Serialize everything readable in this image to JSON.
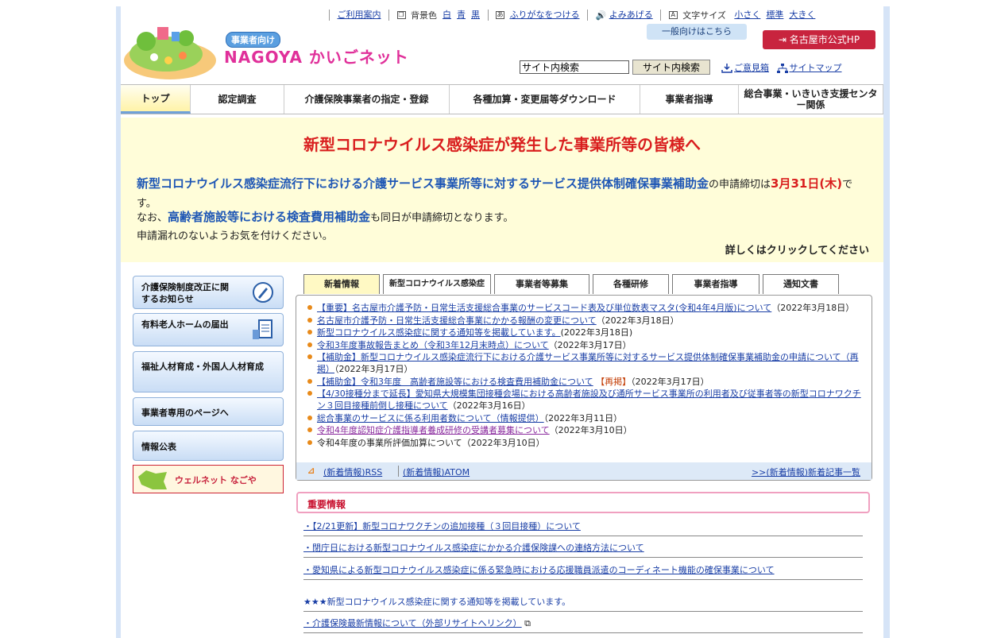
{
  "util": {
    "guide": "ご利用案内",
    "bg_label": "背景色",
    "bg_white": "白",
    "bg_blue": "青",
    "bg_black": "黒",
    "furigana": "ふりがなをつける",
    "read": "よみあげる",
    "size_label": "文字サイズ",
    "size_small": "小さく",
    "size_std": "標準",
    "size_large": "大きく"
  },
  "header": {
    "logo_sub": "事業者向け",
    "logo_main": "NAGOYA かいごネット",
    "general": "一般向けはこちら",
    "city_hp": "名古屋市公式HP",
    "search_value": "サイト内検索",
    "search_button": "サイト内検索",
    "opinion": "ご意見箱",
    "sitemap": "サイトマップ"
  },
  "nav": {
    "top": "トップ",
    "survey": "認定調査",
    "designation": "介護保険事業者の指定・登録",
    "download": "各種加算・変更届等ダウンロード",
    "guidance": "事業者指導",
    "general_support": "総合事業・いきいき支援センター関係"
  },
  "banner": {
    "title": "新型コロナウイルス感染症が発生した事業所等の皆様へ",
    "line1_bold": "新型コロナウイルス感染症流行下における介護サービス事業所等に対するサービス提供体制確保事業補助金",
    "line1_mid": "の申請締切は",
    "line1_date": "3月31日(木)",
    "line1_end": "です。",
    "line2_pre": "なお、",
    "line2_bold": "高齢者施設等における検査費用補助金",
    "line2_end": "も同日が申請締切となります。",
    "line3": "申請漏れのないようお気を付けください。",
    "more": "詳しくはクリックしてください"
  },
  "side": {
    "reform": "介護保険制度改正に関するお知らせ",
    "nursing_home": "有料老人ホームの届出",
    "welfare": "福祉人材育成・外国人人材育成",
    "business": "事業者専用のページへ",
    "info": "情報公表",
    "welnet": "ウェルネット なごや"
  },
  "tabs": [
    "新着情報",
    "新型コロナウイルス感染症",
    "事業者等募集",
    "各種研修",
    "事業者指導",
    "通知文書"
  ],
  "news": [
    {
      "link": "【重要】名古屋市介護予防・日常生活支援総合事業のサービスコード表及び単位数表マスタ(令和4年4月版)について",
      "date": "（2022年3月18日）"
    },
    {
      "link": "名古屋市介護予防・日常生活支援総合事業にかかる報酬の変更について",
      "date": "（2022年3月18日）"
    },
    {
      "link": "新型コロナウイルス感染症に関する通知等を掲載しています。",
      "date": "(2022年3月18日)"
    },
    {
      "link": "令和3年度事故報告まとめ（令和3年12月末時点）について",
      "date": "（2022年3月17日）"
    },
    {
      "link": "【補助金】新型コロナウイルス感染症流行下における介護サービス事業所等に対するサービス提供体制確保事業補助金の申請について（再掲）",
      "date": "（2022年3月17日）"
    },
    {
      "link": "【補助金】令和3年度　高齢者施設等における検査費用補助金について",
      "tag": "【再掲】",
      "date": "（2022年3月17日）"
    },
    {
      "link": "【4/30接種分まで延長】愛知県大規模集団接種会場における高齢者施設及び通所サービス事業所の利用者及び従事者等の新型コロナワクチン３回目接種前倒し接種について",
      "date": "（2022年3月16日）"
    },
    {
      "link": "総合事業のサービスに係る利用者数について（情報提供）",
      "date": "（2022年3月11日）"
    },
    {
      "link": "令和4年度認知症介護指導者養成研修の受講者募集について",
      "date": "（2022年3月10日）",
      "visited": true
    },
    {
      "link": "令和4年度の事業所評価加算について",
      "date": "（2022年3月10日）",
      "plain": true
    }
  ],
  "news_foot": {
    "rss": "(新着情報)RSS",
    "atom": "(新着情報)ATOM",
    "list": ">>(新着情報)新着記事一覧"
  },
  "important": {
    "title": "重要情報",
    "items": [
      "・【2/21更新】新型コロナワクチンの追加接種（３回目接種）について",
      "・閉庁日における新型コロナウイルス感染症にかかる介護保険課への連絡方法について",
      "・愛知県による新型コロナウイルス感染症に係る緊急時における応援職員派遣のコーディネート機能の確保事業について",
      "★★★新型コロナウイルス感染症に関する通知等を掲載しています。",
      "・介護保険最新情報について（外部リサイトへリンク）"
    ]
  },
  "colors": {
    "accent_blue": "#1f57b5",
    "alert_red": "#d91e1e",
    "city_red": "#c8243e",
    "banner_bg": "#fffdd9"
  }
}
